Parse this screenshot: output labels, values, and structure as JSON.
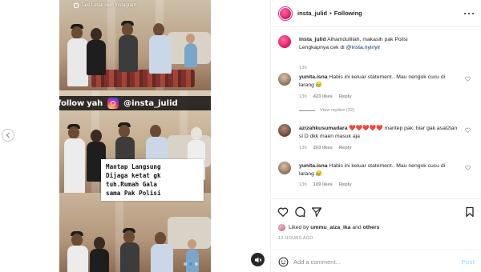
{
  "media": {
    "tag_label": "Tate Letak oleh Instagram",
    "follow_text": "follow yah",
    "follow_handle": "@insta_julid",
    "caption_text": "Mantap Langsung\nDijaga ketat gk\ntuh.Rumah Gala\nsama Pak Polisi",
    "dots_total": 3,
    "dots_active": 1
  },
  "header": {
    "username": "insta_julid",
    "separator": "•",
    "follow_status": "Following"
  },
  "caption": {
    "username": "insta_julid",
    "text_part1": "Alhamdulillah, makasih pak Polisi",
    "text_part2": "Lengkapnya cek di ",
    "mention": "@insta.nyinyir",
    "time": "13h"
  },
  "comments": [
    {
      "username": "yunita.isna",
      "text": "Habis ini keluar statement.. Mau nengok cucu di larang 😥",
      "time": "13h",
      "likes": "423 likes",
      "reply": "Reply",
      "view_replies": "View replies (32)"
    },
    {
      "username": "azizahkusumadara",
      "hearts": "❤️❤️❤️❤️❤️",
      "text": " mantep pak, biar gak asal2lan si D dkk maen masuk aja",
      "time": "13h",
      "likes": "203 likes",
      "reply": "Reply"
    },
    {
      "username": "yunita.isna",
      "text": "Habis ini keluar statement.. Mau nengok cucu di larang 😥",
      "time": "13h",
      "likes": "109 likes",
      "reply": "Reply"
    }
  ],
  "likes": {
    "prefix": "Liked by ",
    "first_user": "ummu_aiza_ika",
    "connector": " and ",
    "others": "others"
  },
  "post_time": "13 HOURS AGO",
  "add_comment": {
    "placeholder": "Add a comment...",
    "post_label": "Post"
  },
  "colors": {
    "accent": "#0095f6",
    "link": "#00376b",
    "muted": "#8e8e8e"
  },
  "icons": [
    "chevron-left-icon",
    "instagram-icon",
    "more-icon",
    "heart-icon",
    "comment-icon",
    "share-icon",
    "bookmark-icon",
    "emoji-icon",
    "mute-icon"
  ]
}
